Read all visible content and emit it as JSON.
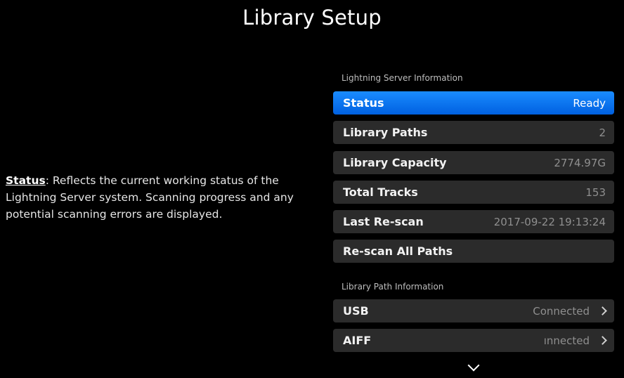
{
  "header": {
    "title": "Library Setup"
  },
  "help": {
    "term": "Status",
    "description": ": Reflects the current working status of the Lightning Server system. Scanning progress and any potential scanning errors are displayed."
  },
  "server_info": {
    "section_label": "Lightning Server Information",
    "rows": [
      {
        "label": "Status",
        "value": "Ready"
      },
      {
        "label": "Library Paths",
        "value": "2"
      },
      {
        "label": "Library Capacity",
        "value": "2774.97G"
      },
      {
        "label": "Total Tracks",
        "value": "153"
      },
      {
        "label": "Last Re-scan",
        "value": "2017-09-22 19:13:24"
      },
      {
        "label": "Re-scan All Paths",
        "value": ""
      }
    ]
  },
  "path_info": {
    "section_label": "Library Path Information",
    "rows": [
      {
        "label": "USB",
        "value": "Connected"
      },
      {
        "label": "AIFF",
        "value": "ınnected"
      }
    ]
  },
  "colors": {
    "accent": "#0a7cff",
    "row_bg": "#2b2b2b",
    "background": "#000000"
  },
  "icons": {
    "row_arrow": "chevron-right-icon",
    "scroll": "chevron-down-icon"
  }
}
